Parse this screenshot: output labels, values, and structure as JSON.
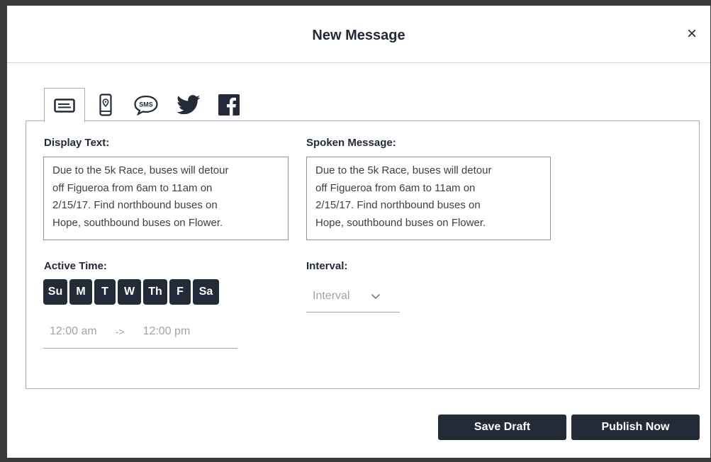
{
  "modal": {
    "title": "New Message",
    "close_label": "×"
  },
  "tabs": [
    {
      "icon": "message-icon",
      "active": true
    },
    {
      "icon": "phone-location-icon",
      "active": false
    },
    {
      "icon": "sms-icon",
      "label": "SMS",
      "active": false
    },
    {
      "icon": "twitter-icon",
      "active": false
    },
    {
      "icon": "facebook-icon",
      "active": false
    }
  ],
  "display_text": {
    "label": "Display Text:",
    "lines": [
      "Due to the 5k Race, buses will detour",
      "off Figueroa from 6am to 11am on",
      "2/15/17. Find northbound buses on",
      "Hope, southbound buses on Flower."
    ]
  },
  "spoken_message": {
    "label": "Spoken Message:",
    "lines": [
      "Due to the 5k Race, buses will detour",
      "off Figueroa from 6am to 11am on",
      "2/15/17. Find northbound buses on",
      "Hope, southbound buses on Flower."
    ]
  },
  "active_time": {
    "label": "Active Time:",
    "days": [
      "Su",
      "M",
      "T",
      "W",
      "Th",
      "F",
      "Sa"
    ],
    "start": "12:00 am",
    "arrow": "->",
    "end": "12:00 pm"
  },
  "interval": {
    "label": "Interval:",
    "placeholder": "Interval"
  },
  "actions": {
    "save_draft": "Save Draft",
    "publish_now": "Publish Now"
  },
  "colors": {
    "primary": "#232a38",
    "border": "#a9adb3",
    "placeholder": "#a0a4aa"
  }
}
